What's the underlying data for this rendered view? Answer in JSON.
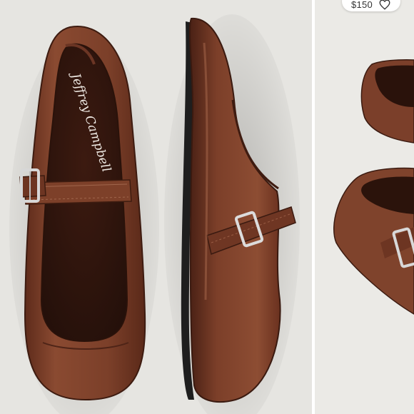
{
  "listing": {
    "brand_print": "Jeffrey Campbell",
    "price": "$150",
    "icons": {
      "like": "heart-outline-icon"
    }
  },
  "colors": {
    "background": "#e6e5e1",
    "leather": "#7a3d28",
    "leather_dark": "#4a2216",
    "buckle": "#d7d7d7"
  }
}
